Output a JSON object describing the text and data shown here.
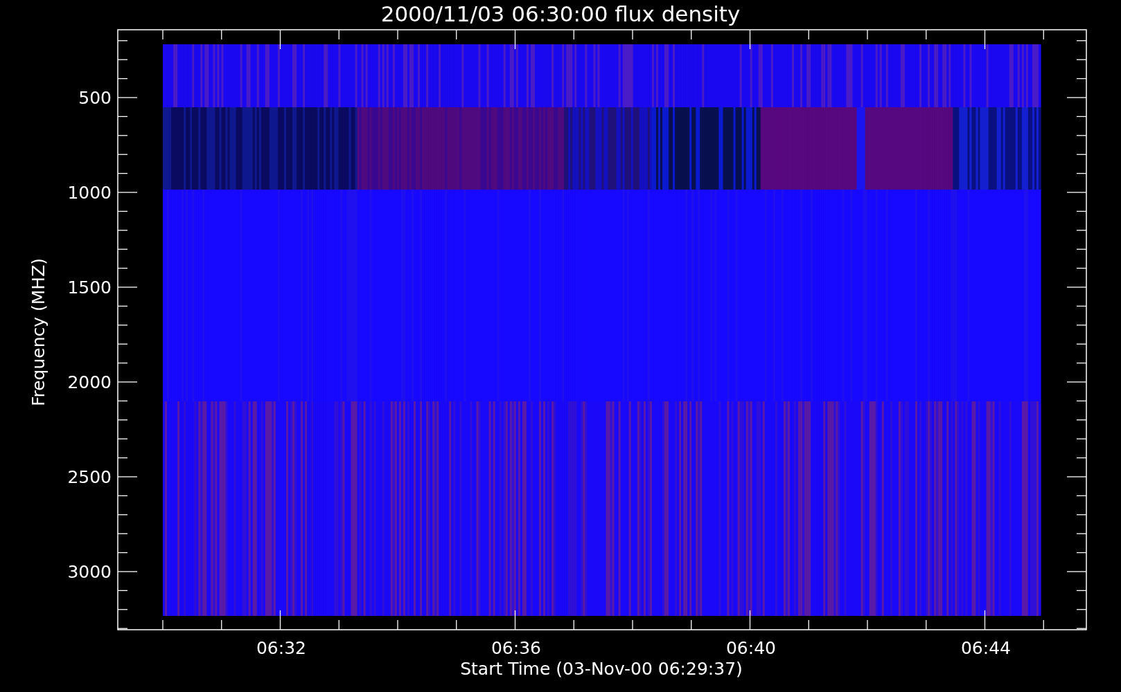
{
  "plot": {
    "title": "2000/11/03 06:30:00 flux density",
    "ylabel": "Frequency (MHZ)",
    "xlabel": "Start Time (03-Nov-00 06:29:37)",
    "yticks": [
      "500",
      "1000",
      "1500",
      "2000",
      "2500",
      "3000"
    ],
    "xticks": [
      "06:32",
      "06:36",
      "06:40",
      "06:44"
    ]
  }
}
